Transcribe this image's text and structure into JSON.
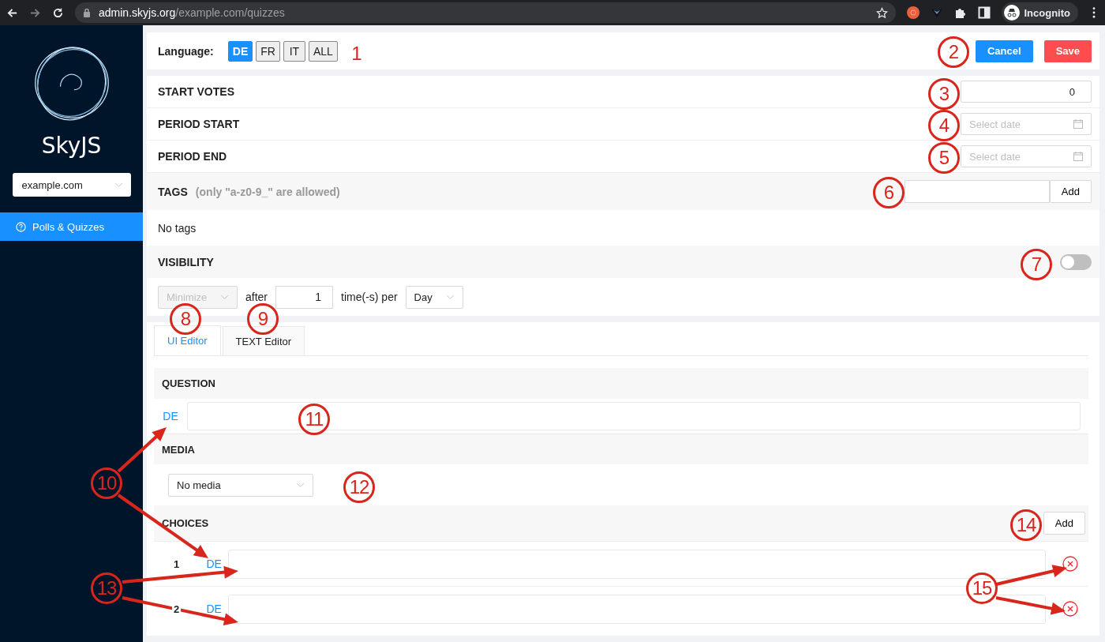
{
  "browser": {
    "url_host": "admin.skyjs.org",
    "url_path": "/example.com/quizzes",
    "profile": "Incognito"
  },
  "sidebar": {
    "brand": "SkyJS",
    "site_select": "example.com",
    "items": [
      {
        "label": "Polls & Quizzes",
        "selected": true
      }
    ]
  },
  "toolbar": {
    "language_label": "Language:",
    "languages": [
      {
        "label": "DE",
        "selected": true
      },
      {
        "label": "FR",
        "selected": false
      },
      {
        "label": "IT",
        "selected": false
      },
      {
        "label": "ALL",
        "selected": false
      }
    ],
    "buttons": [
      {
        "label": "Cancel",
        "kind": "primary"
      },
      {
        "label": "Save",
        "kind": "danger"
      }
    ]
  },
  "settings": {
    "start_votes": {
      "label": "START VOTES",
      "value": "0"
    },
    "period_start": {
      "label": "PERIOD START",
      "placeholder": "Select date"
    },
    "period_end": {
      "label": "PERIOD END",
      "placeholder": "Select date"
    },
    "tags": {
      "label": "TAGS",
      "hint": "(only \"a-z0-9_\" are allowed)",
      "add_button": "Add",
      "empty_text": "No tags"
    },
    "visibility": {
      "label": "VISIBILITY",
      "on": false,
      "action": "Minimize",
      "action_disabled": true,
      "after_label": "after",
      "count": "1",
      "per_label": "time(-s) per",
      "period": "Day"
    }
  },
  "editor": {
    "tabs": [
      {
        "label": "UI Editor",
        "selected": true
      },
      {
        "label": "TEXT Editor",
        "selected": false
      }
    ],
    "question": {
      "label": "QUESTION",
      "lang": "DE"
    },
    "media": {
      "label": "MEDIA",
      "value": "No media"
    },
    "choices": {
      "label": "CHOICES",
      "add_button": "Add",
      "items": [
        {
          "number": "1",
          "lang": "DE"
        },
        {
          "number": "2",
          "lang": "DE"
        }
      ]
    }
  },
  "annotations": [
    {
      "label": "1",
      "kind": "plain"
    },
    {
      "label": "2",
      "kind": "circled"
    },
    {
      "label": "3",
      "kind": "circled"
    },
    {
      "label": "4",
      "kind": "circled"
    },
    {
      "label": "5",
      "kind": "circled"
    },
    {
      "label": "6",
      "kind": "circled"
    },
    {
      "label": "7",
      "kind": "circled"
    },
    {
      "label": "8",
      "kind": "circled"
    },
    {
      "label": "9",
      "kind": "circled"
    },
    {
      "label": "10",
      "kind": "circled"
    },
    {
      "label": "11",
      "kind": "circled"
    },
    {
      "label": "12",
      "kind": "circled"
    },
    {
      "label": "13",
      "kind": "circled"
    },
    {
      "label": "14",
      "kind": "circled"
    },
    {
      "label": "15",
      "kind": "circled"
    }
  ]
}
